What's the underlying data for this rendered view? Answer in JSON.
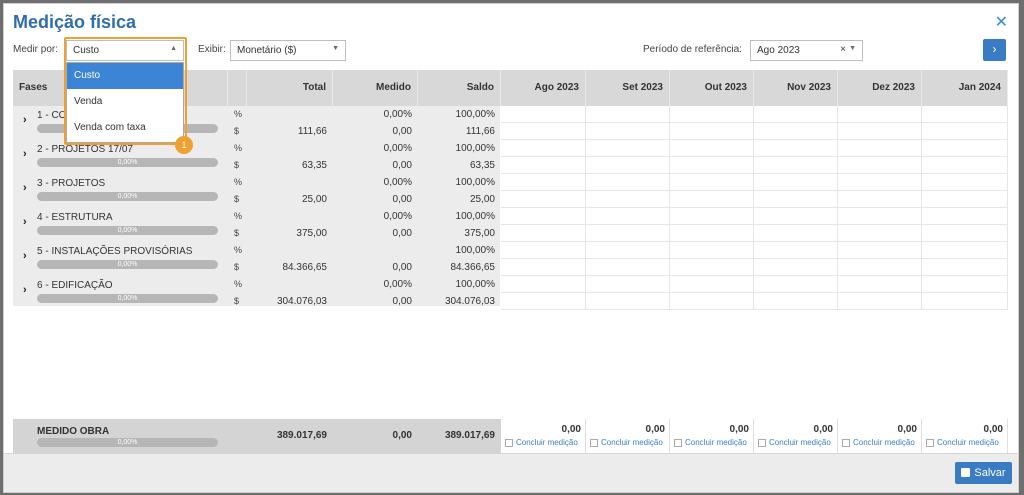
{
  "header": {
    "title": "Medição física"
  },
  "filters": {
    "medir_por_label": "Medir por:",
    "medir_por_value": "Custo",
    "exibir_label": "Exibir:",
    "exibir_value": "Monetário ($)",
    "periodo_label": "Período de referência:",
    "periodo_value": "Ago 2023"
  },
  "dropdown": {
    "options": [
      "Custo",
      "Venda",
      "Venda com taxa"
    ],
    "selected": "Custo"
  },
  "callout_badge": "1",
  "columns": {
    "fases": "Fases",
    "total": "Total",
    "medido": "Medido",
    "saldo": "Saldo",
    "months": [
      "Ago 2023",
      "Set 2023",
      "Out 2023",
      "Nov 2023",
      "Dez 2023",
      "Jan 2024"
    ]
  },
  "units": {
    "percent": "%",
    "money": "$"
  },
  "phases": [
    {
      "name": "1 - CO",
      "progress": "0,00%",
      "pct_medido": "0,00%",
      "pct_saldo": "100,00%",
      "total": "111,66",
      "medido": "0,00",
      "saldo": "111,66"
    },
    {
      "name": "2 - PROJETOS 17/07",
      "progress": "0,00%",
      "pct_medido": "0,00%",
      "pct_saldo": "100,00%",
      "total": "63,35",
      "medido": "0,00",
      "saldo": "63,35"
    },
    {
      "name": "3 - PROJETOS",
      "progress": "0,00%",
      "pct_medido": "0,00%",
      "pct_saldo": "100,00%",
      "total": "25,00",
      "medido": "0,00",
      "saldo": "25,00"
    },
    {
      "name": "4 - ESTRUTURA",
      "progress": "0,00%",
      "pct_medido": "0,00%",
      "pct_saldo": "100,00%",
      "total": "375,00",
      "medido": "0,00",
      "saldo": "375,00"
    },
    {
      "name": "5 - INSTALAÇÕES PROVISÓRIAS",
      "progress": "0,00%",
      "pct_medido": "",
      "pct_saldo": "100,00%",
      "total": "84.366,65",
      "medido": "0,00",
      "saldo": "84.366,65"
    },
    {
      "name": "6 - EDIFICAÇÃO",
      "progress": "0,00%",
      "pct_medido": "0,00%",
      "pct_saldo": "100,00%",
      "total": "304.076,03",
      "medido": "0,00",
      "saldo": "304.076,03"
    }
  ],
  "footer": {
    "label": "MEDIDO OBRA",
    "progress": "0,00%",
    "total": "389.017,69",
    "medido": "0,00",
    "saldo": "389.017,69",
    "month_values": [
      "0,00",
      "0,00",
      "0,00",
      "0,00",
      "0,00",
      "0,00"
    ],
    "concluir_label": "Concluir medição"
  },
  "actions": {
    "save_label": "Salvar"
  }
}
